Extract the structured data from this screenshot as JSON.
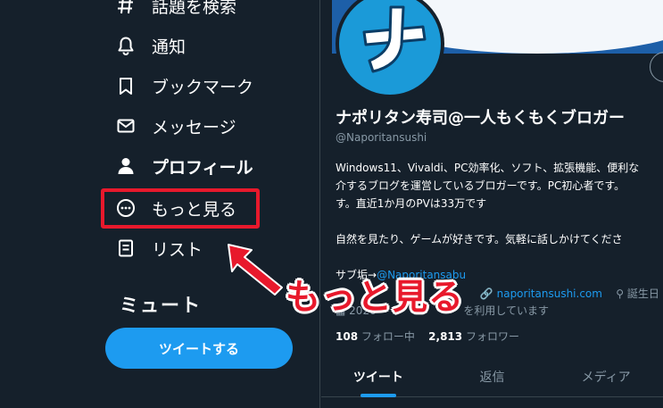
{
  "sidebar": {
    "items": [
      {
        "label": "話題を検索",
        "icon": "hash-icon"
      },
      {
        "label": "通知",
        "icon": "bell-icon"
      },
      {
        "label": "ブックマーク",
        "icon": "bookmark-icon"
      },
      {
        "label": "メッセージ",
        "icon": "mail-icon"
      },
      {
        "label": "プロフィール",
        "icon": "person-icon"
      },
      {
        "label": "もっと見る",
        "icon": "more-circle-icon"
      },
      {
        "label": "リスト",
        "icon": "list-icon"
      }
    ],
    "section_title": "ミュート",
    "tweet_button": "ツイートする"
  },
  "annotation": {
    "callout": "もっと見る",
    "color": "#e8192c"
  },
  "profile": {
    "display_name": "ナポリタン寿司@一人もくもくブロガー",
    "handle": "@Naporitansushi",
    "bio_lines": [
      "Windows11、Vivaldi、PC効率化、ソフト、拡張機能、便利な",
      "介するブログを運営しているブロガーです。PC初心者です。",
      "す。直近1か月のPVは33万です",
      "自然を見たり、ゲームが好きです。気軽に話しかけてくださ"
    ],
    "sub_prefix": "サブ垢→",
    "sub_link": "@Naporitansabu",
    "website": "naporitansushi.com",
    "birthday": "誕生日",
    "joined_fragment": "を利用しています",
    "joined_year": "2020",
    "following_count": "108",
    "following_label": "フォロー中",
    "followers_count": "2,813",
    "followers_label": "フォロワー"
  },
  "tabs": [
    "ツイート",
    "返信",
    "メディア"
  ],
  "colors": {
    "background": "#15202b",
    "accent": "#1d9bf0",
    "muted": "#8899a6"
  }
}
